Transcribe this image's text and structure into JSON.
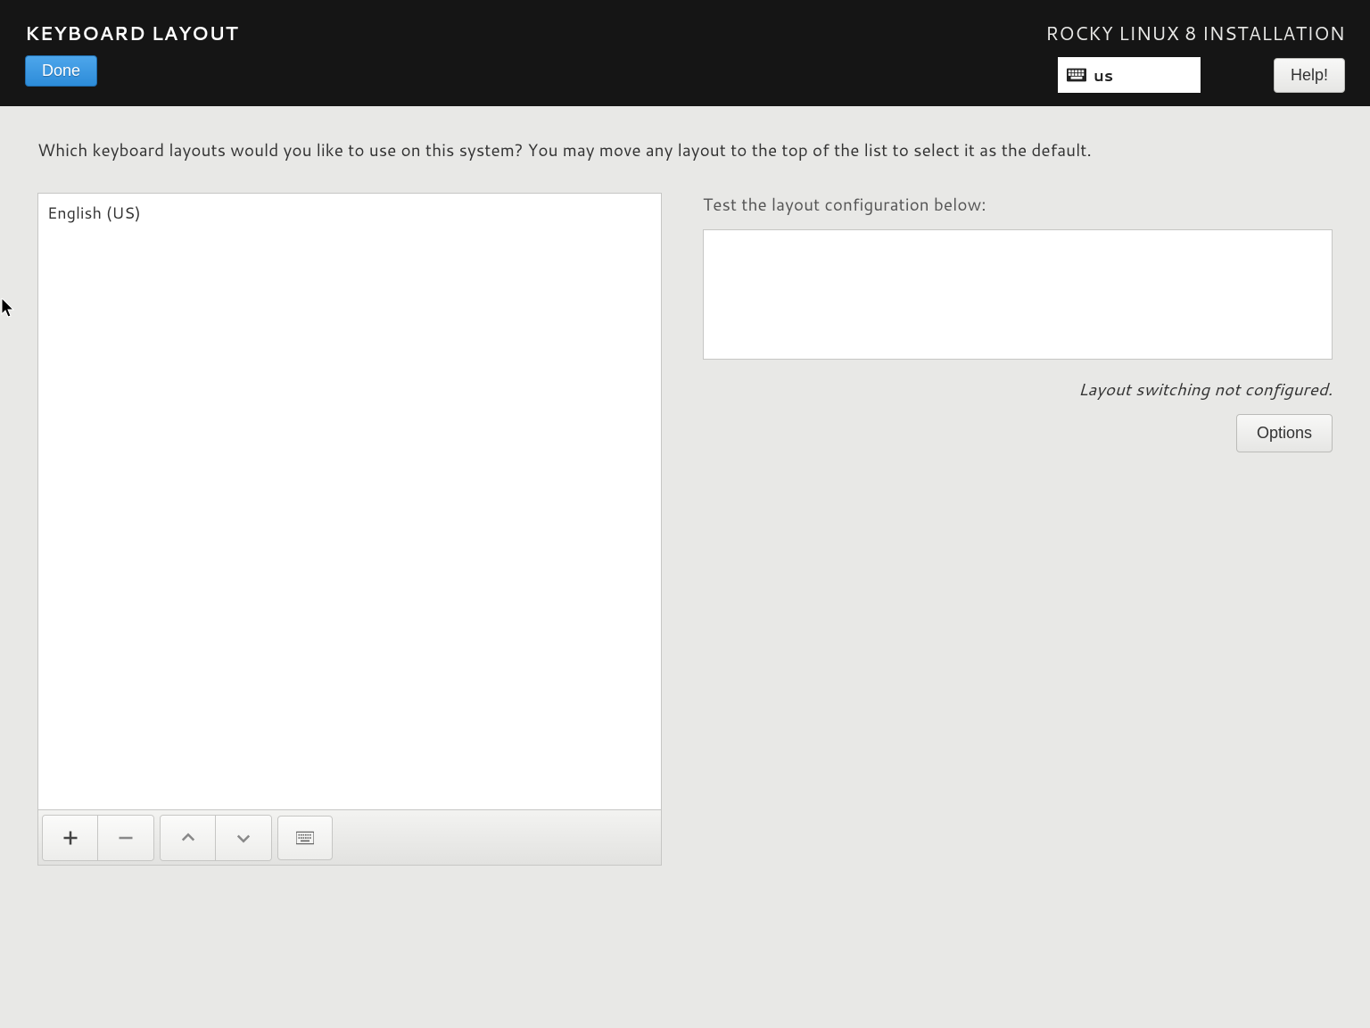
{
  "header": {
    "title": "KEYBOARD LAYOUT",
    "done_label": "Done",
    "product": "ROCKY LINUX 8 INSTALLATION",
    "kb_code": "us",
    "help_label": "Help!"
  },
  "instruction": "Which keyboard layouts would you like to use on this system?  You may move any layout to the top of the list to select it as the default.",
  "layouts": [
    "English (US)"
  ],
  "right": {
    "test_label": "Test the layout configuration below:",
    "test_value": "",
    "switch_note": "Layout switching not configured.",
    "options_label": "Options"
  }
}
